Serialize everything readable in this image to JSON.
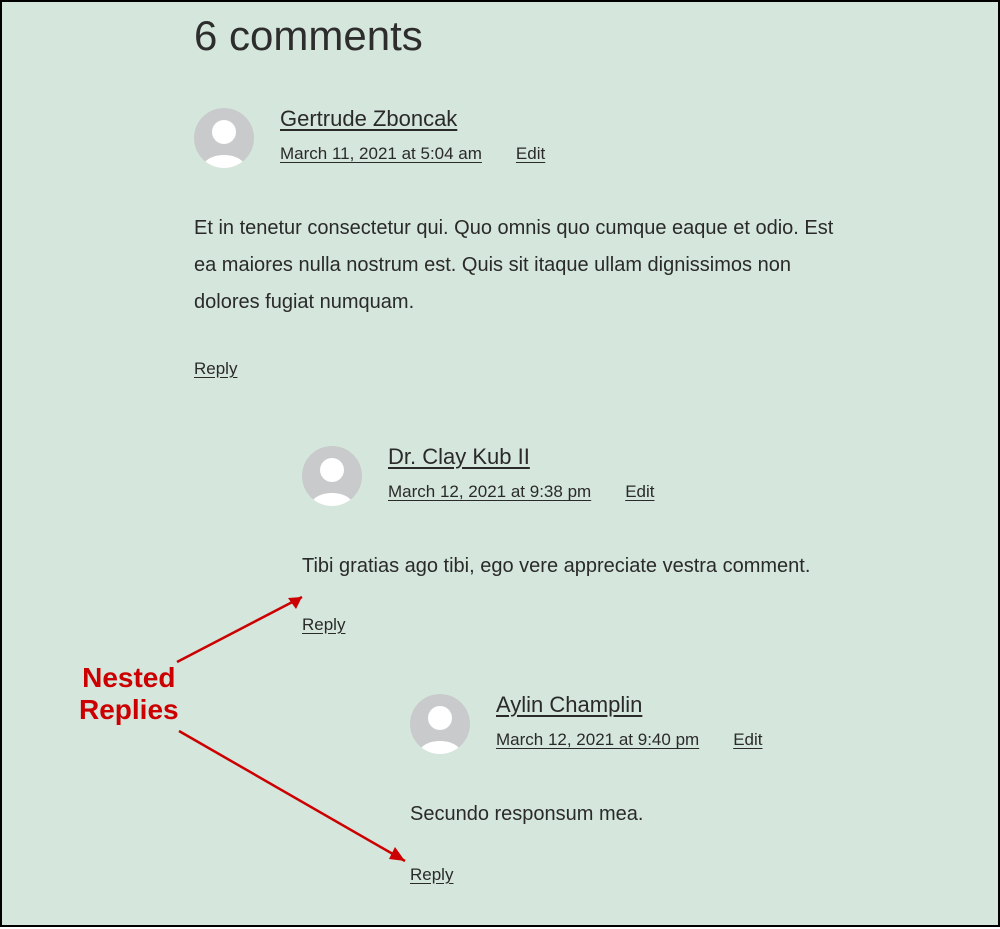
{
  "heading": "6 comments",
  "labels": {
    "edit": "Edit",
    "reply": "Reply"
  },
  "comments": [
    {
      "author": "Gertrude Zboncak",
      "timestamp": "March 11, 2021 at 5:04 am",
      "body": "Et in tenetur consectetur qui. Quo omnis quo cumque eaque et odio. Est ea maiores nulla nostrum est. Quis sit itaque ullam dignissimos non dolores fugiat numquam."
    },
    {
      "author": "Dr. Clay Kub II",
      "timestamp": "March 12, 2021 at 9:38 pm",
      "body": "Tibi gratias ago tibi, ego vere appreciate vestra comment."
    },
    {
      "author": "Aylin Champlin",
      "timestamp": "March 12, 2021 at 9:40 pm",
      "body": "Secundo responsum mea."
    }
  ],
  "annotation": {
    "label": "Nested\nReplies"
  }
}
